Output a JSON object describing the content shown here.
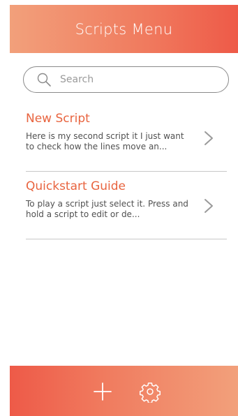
{
  "header": {
    "title": "Scripts Menu"
  },
  "search": {
    "placeholder": "Search"
  },
  "scripts": [
    {
      "title": "New Script",
      "description": "Here is my second script it I just want to check how the lines move an..."
    },
    {
      "title": "Quickstart Guide",
      "description": "To play a script just select it. Press and hold a script to edit or de..."
    }
  ],
  "footer": {
    "add_icon": "plus-icon",
    "settings_icon": "gear-icon"
  },
  "colors": {
    "accent": "#e8643f",
    "header_light": "#f2a07b",
    "header_dark": "#ee5a48"
  }
}
